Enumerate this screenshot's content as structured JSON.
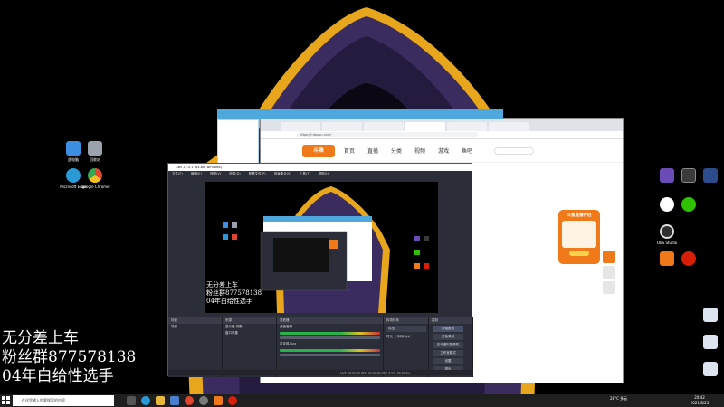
{
  "overlay": {
    "line1": "无分差上车",
    "line2": "粉丝群877578138",
    "line3": "04年白给性选手"
  },
  "desktop_icons_left": [
    {
      "label": "此电脑",
      "icon": "computer-icon",
      "color": "#3c8ee0"
    },
    {
      "label": "回收站",
      "icon": "recycle-bin-icon",
      "color": "#9aa3ad"
    },
    {
      "label": "Microsoft Edge",
      "icon": "edge-icon",
      "color": "#2a9ad6"
    },
    {
      "label": "Google Chrome",
      "icon": "chrome-icon",
      "color": "#e0462f"
    }
  ],
  "desktop_icons_right": [
    {
      "label": "",
      "icon": "game-icon-1",
      "color": "#6b4bb5"
    },
    {
      "label": "",
      "icon": "game-icon-2",
      "color": "#3a3a3a"
    },
    {
      "label": "",
      "icon": "game-icon-3",
      "color": "#2c4b8a"
    },
    {
      "label": "",
      "icon": "qq-icon",
      "color": "#ffffff"
    },
    {
      "label": "",
      "icon": "wechat-icon",
      "color": "#2dc100"
    },
    {
      "label": "OBS Studio",
      "icon": "obs-icon",
      "color": "#302e31"
    },
    {
      "label": "",
      "icon": "douyu-icon",
      "color": "#f07a1a"
    },
    {
      "label": "",
      "icon": "netease-icon",
      "color": "#d81e06"
    }
  ],
  "desktop_files_right": [
    {
      "label": "",
      "icon": "file-icon",
      "color": "#dde6f0"
    },
    {
      "label": "",
      "icon": "file-icon",
      "color": "#dde6f0"
    },
    {
      "label": "",
      "icon": "file-icon",
      "color": "#dde6f0"
    }
  ],
  "browser": {
    "tabs": [
      {
        "label": ""
      },
      {
        "label": ""
      },
      {
        "label": ""
      },
      {
        "label": ""
      },
      {
        "label": ""
      },
      {
        "label": ""
      }
    ],
    "url": "https://i.douyu.com/",
    "logo": "斗鱼",
    "nav": [
      "首页",
      "直播",
      "分类",
      "视频",
      "游戏",
      "鱼吧"
    ],
    "search_placeholder": "",
    "promo_title": "斗鱼直播伴侣"
  },
  "music_player": {
    "title": "",
    "menu": [
      "",
      "",
      "",
      "",
      ""
    ]
  },
  "obs": {
    "title": "OBS 27.0.1 (64-bit, windows)",
    "menu": [
      "文件(F)",
      "编辑(E)",
      "视图(V)",
      "停靠(D)",
      "配置文件(P)",
      "场景集合(S)",
      "工具(T)",
      "帮助(H)"
    ],
    "docks": {
      "scenes": "场景",
      "sources": "来源",
      "mixer": "混音器",
      "transitions": "转场特效",
      "controls": "控制"
    },
    "scene_items": [
      "场景"
    ],
    "source_items": [
      "显示器 采集",
      "窗口采集"
    ],
    "mixer_items": [
      "桌面音频",
      "麦克风/Aux"
    ],
    "transition_type": "淡出",
    "transition_duration_label": "时长",
    "transition_duration": "300 ms",
    "controls": [
      "开始推流",
      "开始录制",
      "启动虚拟摄像机",
      "工作室模式",
      "设置",
      "退出"
    ],
    "status": "LIVE: 00:00:00   REC: 00:00:00   CPU: 3.5%, 60.00 fps"
  },
  "taskbar": {
    "search_placeholder": "在这里输入你要搜索的内容",
    "tray_weather": "28°C 多云",
    "clock_time": "20:42",
    "clock_date": "2021/8/25",
    "apps": [
      {
        "icon": "task-view-icon",
        "color": "#555"
      },
      {
        "icon": "edge-icon",
        "color": "#2a9ad6"
      },
      {
        "icon": "explorer-icon",
        "color": "#e8b83a"
      },
      {
        "icon": "store-icon",
        "color": "#4a7fd0"
      },
      {
        "icon": "chrome-icon",
        "color": "#e0462f"
      },
      {
        "icon": "obs-icon",
        "color": "#7a7a7a"
      },
      {
        "icon": "douyu-icon",
        "color": "#f07a1a"
      },
      {
        "icon": "music-icon",
        "color": "#d81e06"
      }
    ]
  }
}
